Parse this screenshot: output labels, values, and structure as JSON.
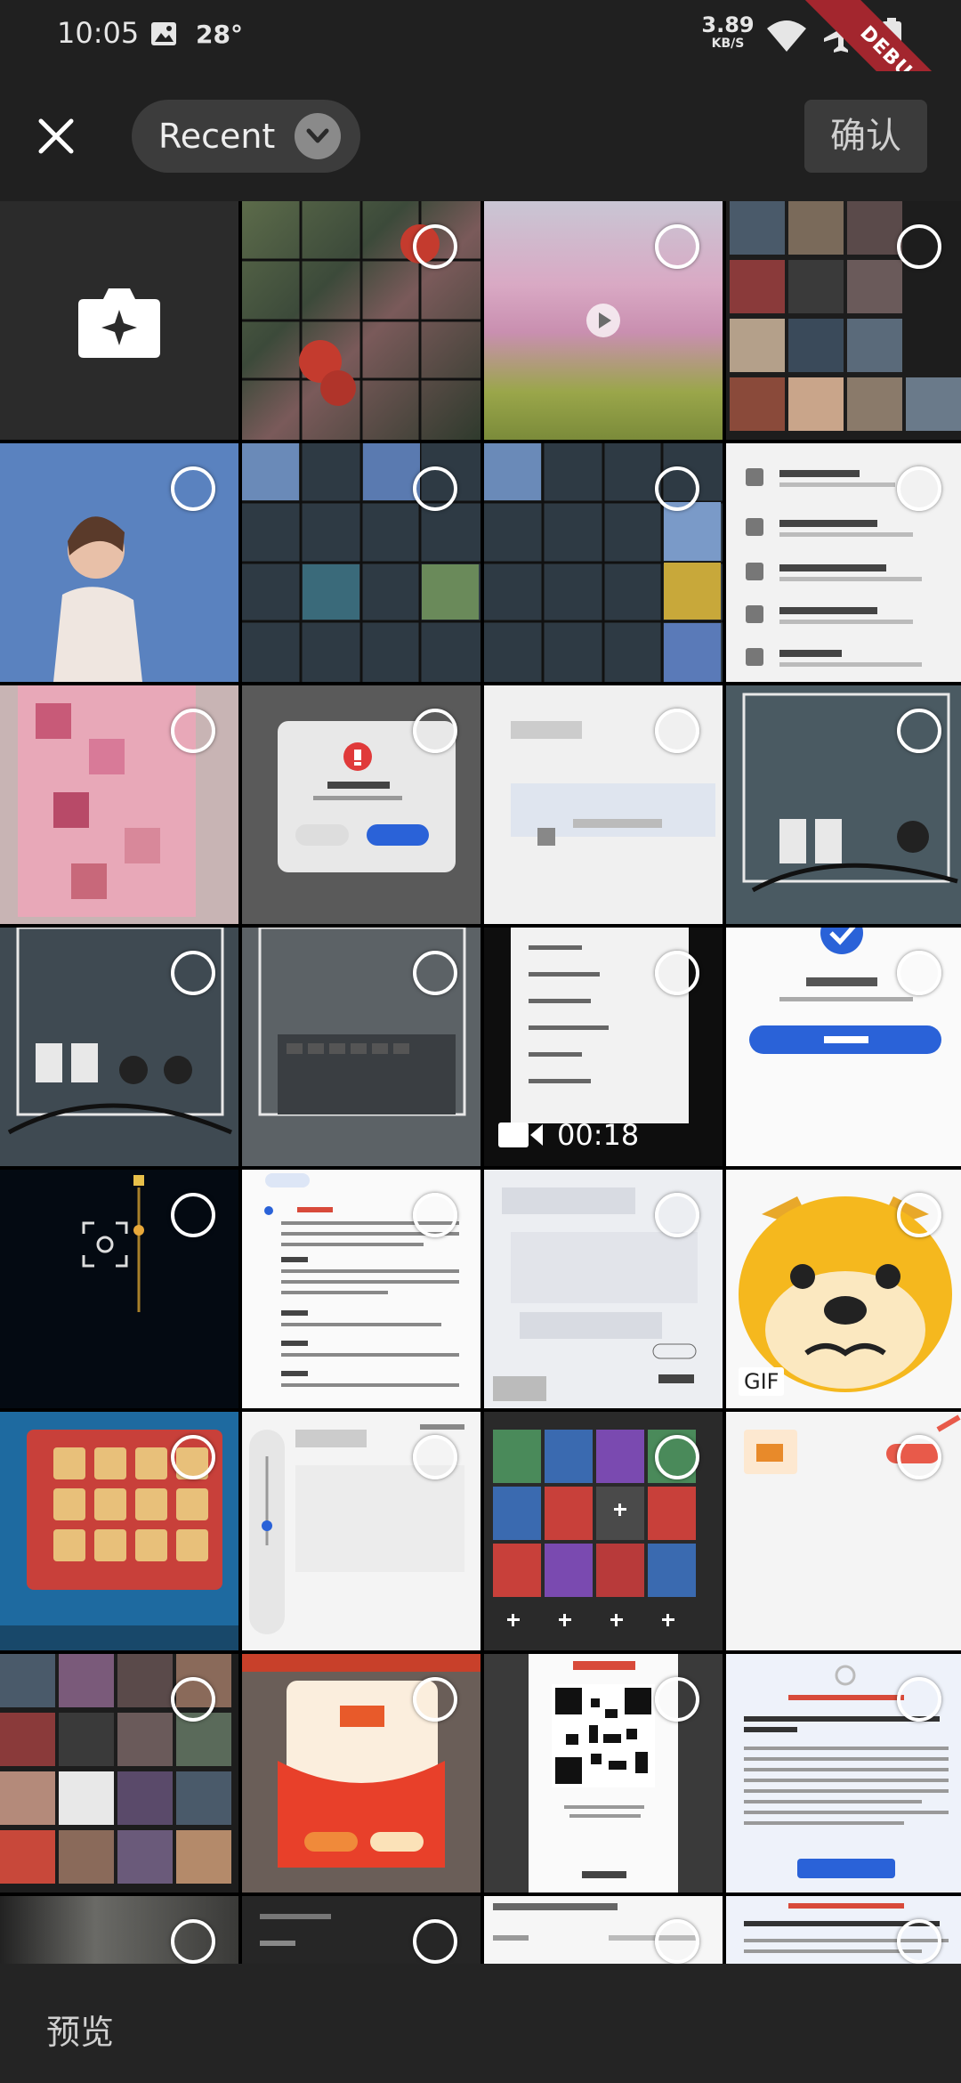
{
  "status_bar": {
    "time": "10:05",
    "temperature": "28°",
    "net_speed": "3.89",
    "net_unit": "KB/S"
  },
  "debug_banner": "DEBUG",
  "top_bar": {
    "album_label": "Recent",
    "confirm_label": "确认"
  },
  "grid": {
    "video_duration": "00:18",
    "gif_badge": "GIF"
  },
  "bottom_bar": {
    "preview_label": "预览"
  },
  "colors": {
    "background": "#1b1b1b",
    "bar": "#202020",
    "chip": "#3c3c3c"
  }
}
